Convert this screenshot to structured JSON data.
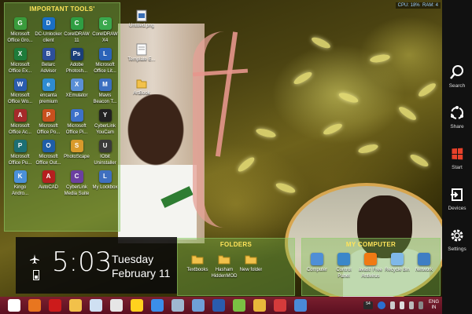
{
  "tools_fence": {
    "title": "IMPORTANT TOOLS'",
    "apps": [
      {
        "label": "Microsoft Office Gro...",
        "icon": "office-groove-icon",
        "color": "#3a9b3c",
        "glyph": "G"
      },
      {
        "label": "DC-Unlocker client",
        "icon": "dc-unlocker-icon",
        "color": "#1a6fc4",
        "glyph": "D"
      },
      {
        "label": "CorelDRAW 11",
        "icon": "coreldraw-11-icon",
        "color": "#2f9e43",
        "glyph": "C"
      },
      {
        "label": "CorelDRAW X4",
        "icon": "coreldraw-x4-icon",
        "color": "#3aa84e",
        "glyph": "C"
      },
      {
        "label": "Microsoft Office Ex...",
        "icon": "office-excel-icon",
        "color": "#1e7b3a",
        "glyph": "X"
      },
      {
        "label": "Belarc Advisor",
        "icon": "belarc-advisor-icon",
        "color": "#2d4f9a",
        "glyph": "B"
      },
      {
        "label": "Adobe Photosh...",
        "icon": "adobe-photoshop-icon",
        "color": "#1a3e78",
        "glyph": "Ps"
      },
      {
        "label": "Microsoft Office Lit...",
        "icon": "office-lite-icon",
        "color": "#2b63b8",
        "glyph": "L"
      },
      {
        "label": "Microsoft Office Wo...",
        "icon": "office-word-icon",
        "color": "#2a5cad",
        "glyph": "W"
      },
      {
        "label": "encanta premium",
        "icon": "encarta-icon",
        "color": "#2e8bd1",
        "glyph": "e"
      },
      {
        "label": "XEmulator",
        "icon": "xemulator-icon",
        "color": "#5a8fd6",
        "glyph": "X"
      },
      {
        "label": "Mavis Beacon T...",
        "icon": "mavis-beacon-icon",
        "color": "#3b6fc0",
        "glyph": "M"
      },
      {
        "label": "Microsoft Office Ac...",
        "icon": "office-access-icon",
        "color": "#a52a2a",
        "glyph": "A"
      },
      {
        "label": "Microsoft Office Po...",
        "icon": "office-powerpoint-icon",
        "color": "#c8501e",
        "glyph": "P"
      },
      {
        "label": "Microsoft Office Pi...",
        "icon": "office-picture-icon",
        "color": "#3d71c9",
        "glyph": "P"
      },
      {
        "label": "CyberLink YouCam",
        "icon": "youcam-icon",
        "color": "#222222",
        "glyph": "Y"
      },
      {
        "label": "Microsoft Office Pu...",
        "icon": "office-publisher-icon",
        "color": "#1d6f74",
        "glyph": "P"
      },
      {
        "label": "Microsoft Office Out...",
        "icon": "office-outlook-icon",
        "color": "#1f5ea8",
        "glyph": "O"
      },
      {
        "label": "PhotoScape",
        "icon": "photoscape-icon",
        "color": "#d99a2b",
        "glyph": "S"
      },
      {
        "label": "IObit Uninstaller",
        "icon": "iobit-uninstaller-icon",
        "color": "#3a3a3a",
        "glyph": "U"
      },
      {
        "label": "Kingo Andro...",
        "icon": "kingo-android-icon",
        "color": "#4a90d9",
        "glyph": "K"
      },
      {
        "label": "AutoCAD",
        "icon": "autocad-icon",
        "color": "#b51f1f",
        "glyph": "A"
      },
      {
        "label": "CyberLink Media Suite",
        "icon": "cyberlink-media-suite-icon",
        "color": "#6b3fa0",
        "glyph": "C"
      },
      {
        "label": "My Lockbox",
        "icon": "my-lockbox-icon",
        "color": "#3f6fbf",
        "glyph": "L"
      }
    ]
  },
  "folders_fence": {
    "title": "FOLDERS",
    "items": [
      {
        "label": "Textbooks",
        "icon": "folder-icon"
      },
      {
        "label": "Hasham HiddenMOD",
        "icon": "folder-icon"
      },
      {
        "label": "New folder",
        "icon": "folder-icon"
      }
    ]
  },
  "computer_fence": {
    "title": "MY COMPUTER",
    "items": [
      {
        "label": "Computer",
        "icon": "computer-icon",
        "color": "#4f8fd6"
      },
      {
        "label": "Control Panel",
        "icon": "control-panel-icon",
        "color": "#3b87c9"
      },
      {
        "label": "avast! Free Antivirus",
        "icon": "avast-icon",
        "color": "#f07a14"
      },
      {
        "label": "Recycle Bin",
        "icon": "recycle-bin-icon",
        "color": "#7fb8e8"
      },
      {
        "label": "Network",
        "icon": "network-icon",
        "color": "#3f7ec4"
      }
    ]
  },
  "desktop_icons": [
    {
      "label": "Untitled.png",
      "icon": "image-file-icon"
    },
    {
      "label": "Template E...",
      "icon": "document-file-icon"
    },
    {
      "label": "ArtBook",
      "icon": "folder-icon"
    }
  ],
  "sysbar": {
    "cpu": "CPU: 18%",
    "ram": "RAM: 4"
  },
  "lock_clock": {
    "time": "5:03",
    "day": "Tuesday",
    "date": "February 11"
  },
  "charms": [
    {
      "label": "Search",
      "icon": "search-icon"
    },
    {
      "label": "Share",
      "icon": "share-icon"
    },
    {
      "label": "Start",
      "icon": "windows-start-icon"
    },
    {
      "label": "Devices",
      "icon": "devices-icon"
    },
    {
      "label": "Settings",
      "icon": "gear-icon"
    }
  ],
  "taskbar": {
    "apps": [
      {
        "name": "start-icon",
        "color": "#ffffff"
      },
      {
        "name": "firefox-icon",
        "color": "#e8761f"
      },
      {
        "name": "opera-icon",
        "color": "#cc1b1b"
      },
      {
        "name": "file-explorer-icon",
        "color": "#f2c14a"
      },
      {
        "name": "document-icon",
        "color": "#cfe0f2"
      },
      {
        "name": "text-file-icon",
        "color": "#e6e6e6"
      },
      {
        "name": "media-icon",
        "color": "#ffd21e"
      },
      {
        "name": "chrome-icon",
        "color": "#3b8eea"
      },
      {
        "name": "tool-icon",
        "color": "#9fb8d0"
      },
      {
        "name": "pen-icon",
        "color": "#6fa0d8"
      },
      {
        "name": "word-icon",
        "color": "#2a5cad"
      },
      {
        "name": "app-icon",
        "color": "#7ac143"
      },
      {
        "name": "photoshop-icon",
        "color": "#e8b83a"
      },
      {
        "name": "camera-icon",
        "color": "#d43b3b"
      },
      {
        "name": "browser-icon",
        "color": "#4a8ad8"
      }
    ],
    "tray_badge": "54",
    "lang_top": "ENG",
    "lang_bottom": "IN"
  }
}
